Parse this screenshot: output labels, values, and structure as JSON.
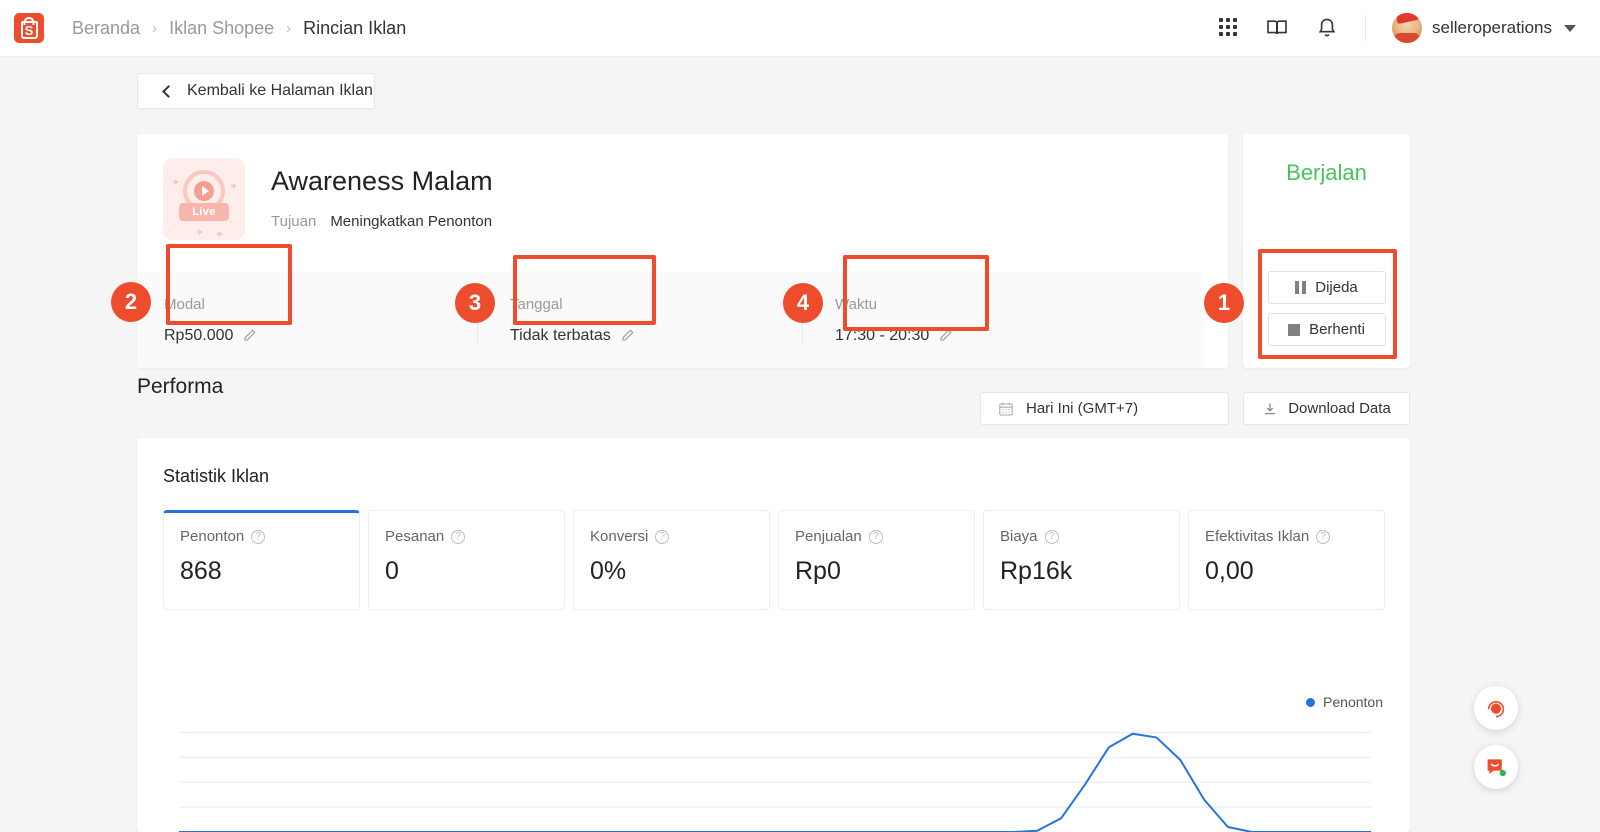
{
  "topbar": {
    "logo_alt": "shopee-logo",
    "breadcrumb": [
      {
        "label": "Beranda",
        "active": false
      },
      {
        "label": "Iklan Shopee",
        "active": false
      },
      {
        "label": "Rincian Iklan",
        "active": true
      }
    ],
    "separator": "›",
    "icons": [
      "apps-grid-icon",
      "book-icon",
      "bell-icon"
    ],
    "account_name": "selleroperations"
  },
  "back_button": {
    "label": "Kembali ke Halaman Iklan",
    "icon": "chevron-left-icon"
  },
  "campaign": {
    "title": "Awareness Malam",
    "objective_label": "Tujuan",
    "objective_value": "Meningkatkan Penonton",
    "thumb_badge": "Live",
    "info": [
      {
        "label": "Modal",
        "value": "Rp50.000",
        "edit_icon": "pencil-icon"
      },
      {
        "label": "Tanggal",
        "value": "Tidak terbatas",
        "edit_icon": "pencil-icon"
      },
      {
        "label": "Waktu",
        "value": "17:30 - 20:30",
        "edit_icon": "pencil-icon"
      }
    ]
  },
  "status": {
    "state": "Berjalan",
    "state_color": "#45c65a",
    "buttons": [
      {
        "label": "Dijeda",
        "icon": "pause-icon"
      },
      {
        "label": "Berhenti",
        "icon": "stop-icon"
      }
    ]
  },
  "performance": {
    "title": "Performa",
    "date_filter": "Hari Ini (GMT+7)",
    "date_icon": "calendar-icon",
    "download_label": "Download Data",
    "download_icon": "download-icon"
  },
  "stats": {
    "title": "Statistik Iklan",
    "help_icon": "question-circle-icon",
    "items": [
      {
        "name": "Penonton",
        "value": "868",
        "active": true
      },
      {
        "name": "Pesanan",
        "value": "0",
        "active": false
      },
      {
        "name": "Konversi",
        "value": "0%",
        "active": false
      },
      {
        "name": "Penjualan",
        "value": "Rp0",
        "active": false
      },
      {
        "name": "Biaya",
        "value": "Rp16k",
        "active": false
      },
      {
        "name": "Efektivitas Iklan",
        "value": "0,00",
        "active": false
      }
    ]
  },
  "chart_data": {
    "type": "line",
    "title": "",
    "xlabel": "",
    "ylabel": "",
    "legend": [
      {
        "name": "Penonton",
        "color": "#2673dd"
      }
    ],
    "legend_position": "top-right",
    "grid": true,
    "gridlines_y": [
      4,
      3,
      2,
      1
    ],
    "series": [
      {
        "name": "Penonton",
        "color": "#2673dd",
        "x": [
          0,
          10,
          20,
          30,
          40,
          50,
          60,
          70,
          72,
          74,
          76,
          78,
          80,
          82,
          84,
          86,
          88,
          90,
          100
        ],
        "values": [
          0,
          0,
          0,
          0,
          0,
          0,
          0,
          0,
          0.05,
          0.55,
          1.9,
          3.4,
          3.95,
          3.8,
          2.9,
          1.3,
          0.2,
          0,
          0
        ]
      }
    ],
    "ylim": [
      0,
      4.3
    ],
    "xlim": [
      0,
      100
    ]
  },
  "fabs": [
    {
      "icon": "support-headset-icon",
      "color": "#ee4d2d"
    },
    {
      "icon": "chat-icon",
      "color": "#ee4d2d",
      "badge_color": "#2fb344"
    }
  ],
  "annotations": [
    {
      "number": "1",
      "target": "status-buttons"
    },
    {
      "number": "2",
      "target": "modal-field"
    },
    {
      "number": "3",
      "target": "tanggal-field"
    },
    {
      "number": "4",
      "target": "waktu-field"
    }
  ]
}
